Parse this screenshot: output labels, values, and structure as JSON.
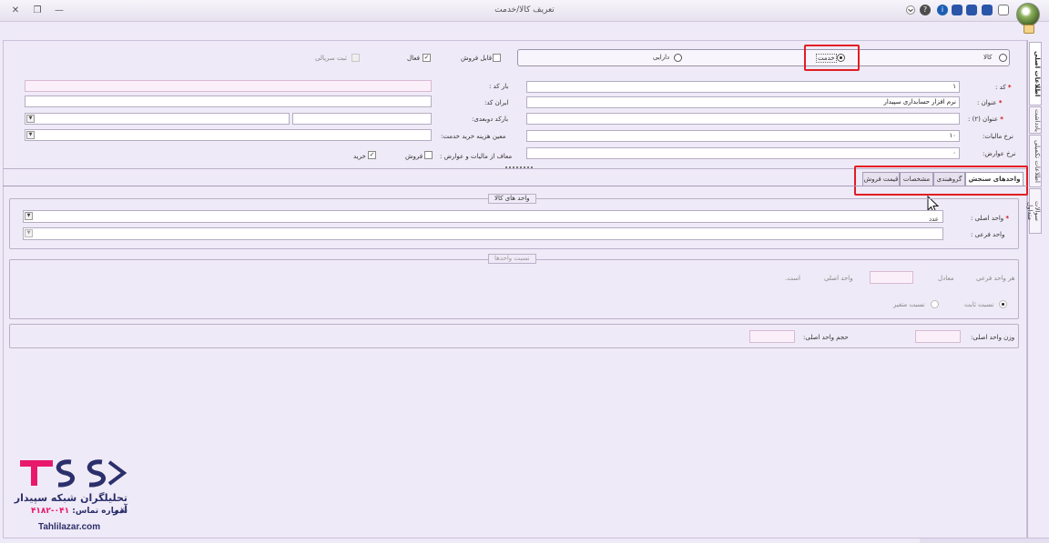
{
  "window": {
    "title": "تعریف کالا/خدمت",
    "close_glyph": "✕",
    "restore_glyph": "❐",
    "minimize_glyph": "—"
  },
  "header_form": {
    "type_options": [
      {
        "label": "کالا",
        "selected": false
      },
      {
        "label": "دارایی",
        "selected": false
      },
      {
        "label": "خدمت",
        "selected": true
      }
    ],
    "checks": {
      "sellable": {
        "label": "قابل فروش",
        "checked": false
      },
      "active": {
        "label": "فعال",
        "checked": true
      },
      "serial": {
        "label": "ثبت سریالی",
        "checked": false,
        "disabled": true
      }
    },
    "fields": {
      "code": {
        "label": "کد :",
        "value": "۱"
      },
      "title": {
        "label": "عنوان :",
        "value": "نرم افزار حسابداری سپیدار"
      },
      "title2": {
        "label": "عنوان (۲) :",
        "value": ""
      },
      "tax_rate": {
        "label": "نرخ مالیات:",
        "value": "۱۰"
      },
      "duty_rate": {
        "label": "نرخ عوارض:",
        "value": "۰"
      },
      "barcode": {
        "label": "بار کد :",
        "value": ""
      },
      "iran_code": {
        "label": "ایران کد:",
        "value": ""
      },
      "barcode_two": {
        "label": "بارکد دوبعدی:",
        "value": ""
      },
      "cost_center": {
        "label": "معین هزینه خرید خدمت:",
        "value": ""
      }
    },
    "exempt": {
      "label": "معاف از مالیات و عوارض :",
      "sale_label": "فروش",
      "sale_checked": false,
      "purchase_label": "خرید",
      "purchase_checked": true
    }
  },
  "tabs": [
    {
      "label": "واحدهای سنجش",
      "active": true
    },
    {
      "label": "گروهبندی",
      "active": false
    },
    {
      "label": "مشخصات",
      "active": false
    },
    {
      "label": "قیمت فروش",
      "active": false
    }
  ],
  "side_tabs": [
    {
      "label": "اطلاعات اصلی",
      "active": true
    },
    {
      "label": "یادداشت",
      "active": false
    },
    {
      "label": "اطلاعات تکمیلی",
      "active": false
    },
    {
      "label": "سوالات متداول",
      "active": false
    }
  ],
  "units": {
    "legend": "واحد های کالا",
    "main_unit": {
      "label": "واحد اصلی :",
      "value": "عدد"
    },
    "sub_unit": {
      "label": "واحد فرعی :",
      "value": ""
    }
  },
  "ratio": {
    "legend": "نسبت واحدها",
    "per_sub_unit": "هر واحد فرعی",
    "equals": "معادل",
    "main_unit_text": "واحد اصلی",
    "is_text": "است.",
    "fixed_label": "نسبت ثابت",
    "variable_label": "نسبت متغیر"
  },
  "measures": {
    "weight_label": "وزن واحد اصلی:",
    "volume_label": "حجم واحد اصلی:"
  },
  "brand": {
    "logo_text": "TSS",
    "company": "تحلیلگران شبکه سپیدار آذر",
    "phone_label": "شماره تماس:",
    "phone": "۰۴۱-۴۱۸۲",
    "website": "Tahlilazar.com"
  },
  "colors": {
    "accent_red": "#e21d24",
    "brand_pink": "#e8196a",
    "brand_navy": "#2b2f6b",
    "background": "#efeaf7"
  },
  "icons": [
    "close-icon",
    "restore-icon",
    "minimize-icon",
    "help-icon",
    "info-icon",
    "save-icon",
    "new-document-icon",
    "app-logo-icon",
    "cursor-icon",
    "dropdown-arrow-icon"
  ]
}
